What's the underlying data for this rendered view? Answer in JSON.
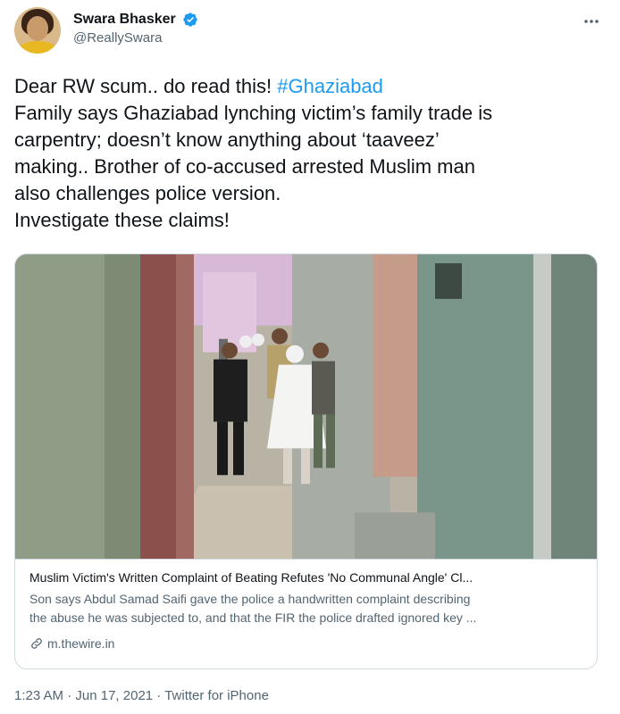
{
  "author": {
    "display_name": "Swara Bhasker",
    "handle": "@ReallySwara",
    "verified_icon": "verified-badge-icon",
    "avatar_icon": "profile-avatar"
  },
  "tweet": {
    "line1_prefix": "Dear RW scum.. do read this! ",
    "hashtag": "#Ghaziabad",
    "line2": "Family says Ghaziabad lynching victim’s family trade is",
    "line3": "carpentry; doesn’t know anything about ‘taaveez’",
    "line4": "making.. Brother of co-accused arrested Muslim man",
    "line5": "also challenges police version.",
    "line6": "Investigate these claims!"
  },
  "card": {
    "title": "Muslim Victim's Written Complaint of Beating Refutes 'No Communal Angle' Cl...",
    "desc_line1": "Son says Abdul Samad Saifi gave the police a handwritten complaint describing",
    "desc_line2": "the abuse he was subjected to, and that the FIR the police drafted ignored key ...",
    "domain": "m.thewire.in"
  },
  "meta": {
    "time": "1:23 AM",
    "separator": " · ",
    "date": "Jun 17, 2021",
    "source": "Twitter for iPhone"
  },
  "colors": {
    "accent": "#1d9bf0",
    "secondary_text": "#536471",
    "border": "#cfd9de"
  }
}
